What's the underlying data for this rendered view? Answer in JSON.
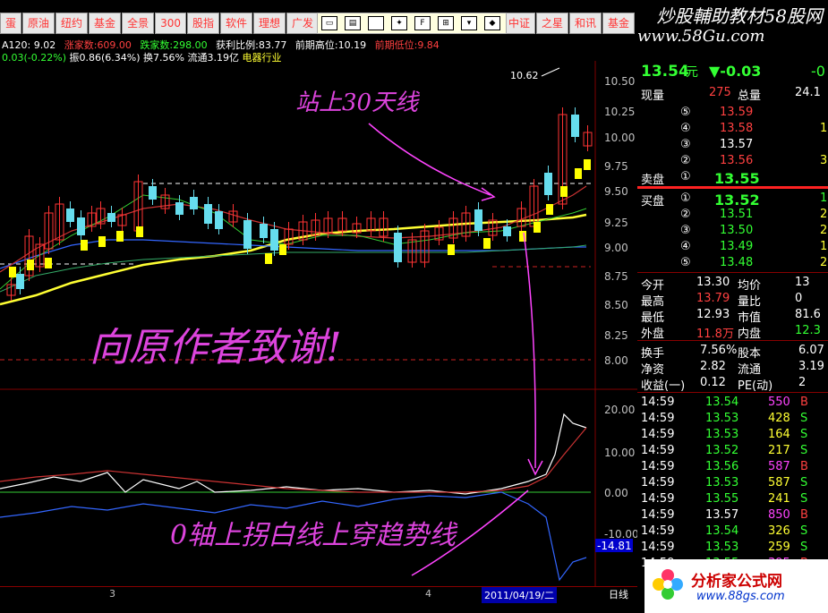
{
  "tabs": [
    "蛋",
    "原油",
    "纽约",
    "基金",
    "全景",
    "300",
    "股指",
    "软件",
    "理想",
    "广发",
    "银冠"
  ],
  "tabs_right": [
    "中证",
    "之星",
    "和讯",
    "基金"
  ],
  "toolbar_icons": [
    "window-icon",
    "window-icon",
    "square-icon",
    "star-icon",
    "f-icon",
    "grid-icon",
    "palette-icon",
    "diamond-icon"
  ],
  "watermark": "炒股輔助教材58股网",
  "site_url": "www.58Gu.com",
  "info_line1": {
    "ma": "A120: 9.02",
    "rise_label": "涨家数:",
    "rise": "609.00",
    "fall_label": "跌家数:",
    "fall": "298.00",
    "ratio_label": "获利比例:",
    "ratio": "83.77",
    "prev_high_label": "前期高位:",
    "prev_high": "10.19",
    "prev_low_label": "前期低位:",
    "prev_low": "9.84"
  },
  "info_line2": {
    "change": "0.03(-0.22%)",
    "amp": "振0.86(6.34%)",
    "turnover": "换7.56%",
    "float": "流通3.19亿",
    "industry": "电器行业"
  },
  "price_axis": [
    "10.50",
    "10.25",
    "10.00",
    "9.75",
    "9.50",
    "9.25",
    "9.00",
    "8.75",
    "8.50",
    "8.25",
    "8.00"
  ],
  "osc_axis": [
    "20.00",
    "10.00",
    "0.00",
    "-10.00"
  ],
  "osc_value": "-14.81",
  "peak_label": "10.62",
  "handwriting": {
    "top": "站上30天线",
    "middle": "向原作者致谢!",
    "bottom": "0轴上拐白线上穿趋势线"
  },
  "bottom_date": "2011/04/19/二",
  "bottom_marks": [
    "3",
    "4"
  ],
  "period": "日线",
  "quote": {
    "price": "13.54",
    "unit": "元",
    "change": "▼-0.03",
    "change_pct": "-0",
    "vol_label": "现量",
    "vol": "275",
    "total_label": "总量",
    "total": "24.1"
  },
  "sell_book": [
    {
      "level": "⑤",
      "price": "13.59",
      "vol": ""
    },
    {
      "level": "④",
      "price": "13.58",
      "vol": "1"
    },
    {
      "level": "③",
      "price": "13.57",
      "vol": ""
    },
    {
      "level": "②",
      "price": "13.56",
      "vol": "3"
    }
  ],
  "sell1": {
    "label": "卖盘",
    "level": "①",
    "price": "13.55"
  },
  "buy1": {
    "label": "买盘",
    "level": "①",
    "price": "13.52",
    "vol": "1"
  },
  "buy_book": [
    {
      "level": "②",
      "price": "13.51",
      "vol": "2"
    },
    {
      "level": "③",
      "price": "13.50",
      "vol": "2"
    },
    {
      "level": "④",
      "price": "13.49",
      "vol": "1"
    },
    {
      "level": "⑤",
      "price": "13.48",
      "vol": "2"
    }
  ],
  "stats": [
    {
      "l1": "今开",
      "v1": "13.30",
      "l2": "均价",
      "v2": "13"
    },
    {
      "l1": "最高",
      "v1": "13.79",
      "l2": "量比",
      "v2": "0"
    },
    {
      "l1": "最低",
      "v1": "12.93",
      "l2": "市值",
      "v2": "81.6"
    },
    {
      "l1": "外盘",
      "v1": "11.8万",
      "l2": "内盘",
      "v2": "12.3"
    }
  ],
  "fund": [
    {
      "l1": "换手",
      "v1": "7.56%",
      "l2": "股本",
      "v2": "6.07"
    },
    {
      "l1": "净资",
      "v1": "2.82",
      "l2": "流通",
      "v2": "3.19"
    },
    {
      "l1": "收益(一)",
      "v1": "0.12",
      "l2": "PE(动)",
      "v2": "2"
    }
  ],
  "ticks": [
    {
      "t": "14:59",
      "p": "13.54",
      "v": "550",
      "s": "B"
    },
    {
      "t": "14:59",
      "p": "13.53",
      "v": "428",
      "s": "S"
    },
    {
      "t": "14:59",
      "p": "13.53",
      "v": "164",
      "s": "S"
    },
    {
      "t": "14:59",
      "p": "13.52",
      "v": "217",
      "s": "S"
    },
    {
      "t": "14:59",
      "p": "13.56",
      "v": "587",
      "s": "B"
    },
    {
      "t": "14:59",
      "p": "13.53",
      "v": "587",
      "s": "S"
    },
    {
      "t": "14:59",
      "p": "13.55",
      "v": "241",
      "s": "S"
    },
    {
      "t": "14:59",
      "p": "13.57",
      "v": "850",
      "s": "B"
    },
    {
      "t": "14:59",
      "p": "13.54",
      "v": "326",
      "s": "S"
    },
    {
      "t": "14:59",
      "p": "13.53",
      "v": "259",
      "s": "S"
    },
    {
      "t": "14:59",
      "p": "13.55",
      "v": "395",
      "s": "B"
    }
  ],
  "logo_text": "分析家公式网",
  "logo_url": "www.88gs.com"
}
